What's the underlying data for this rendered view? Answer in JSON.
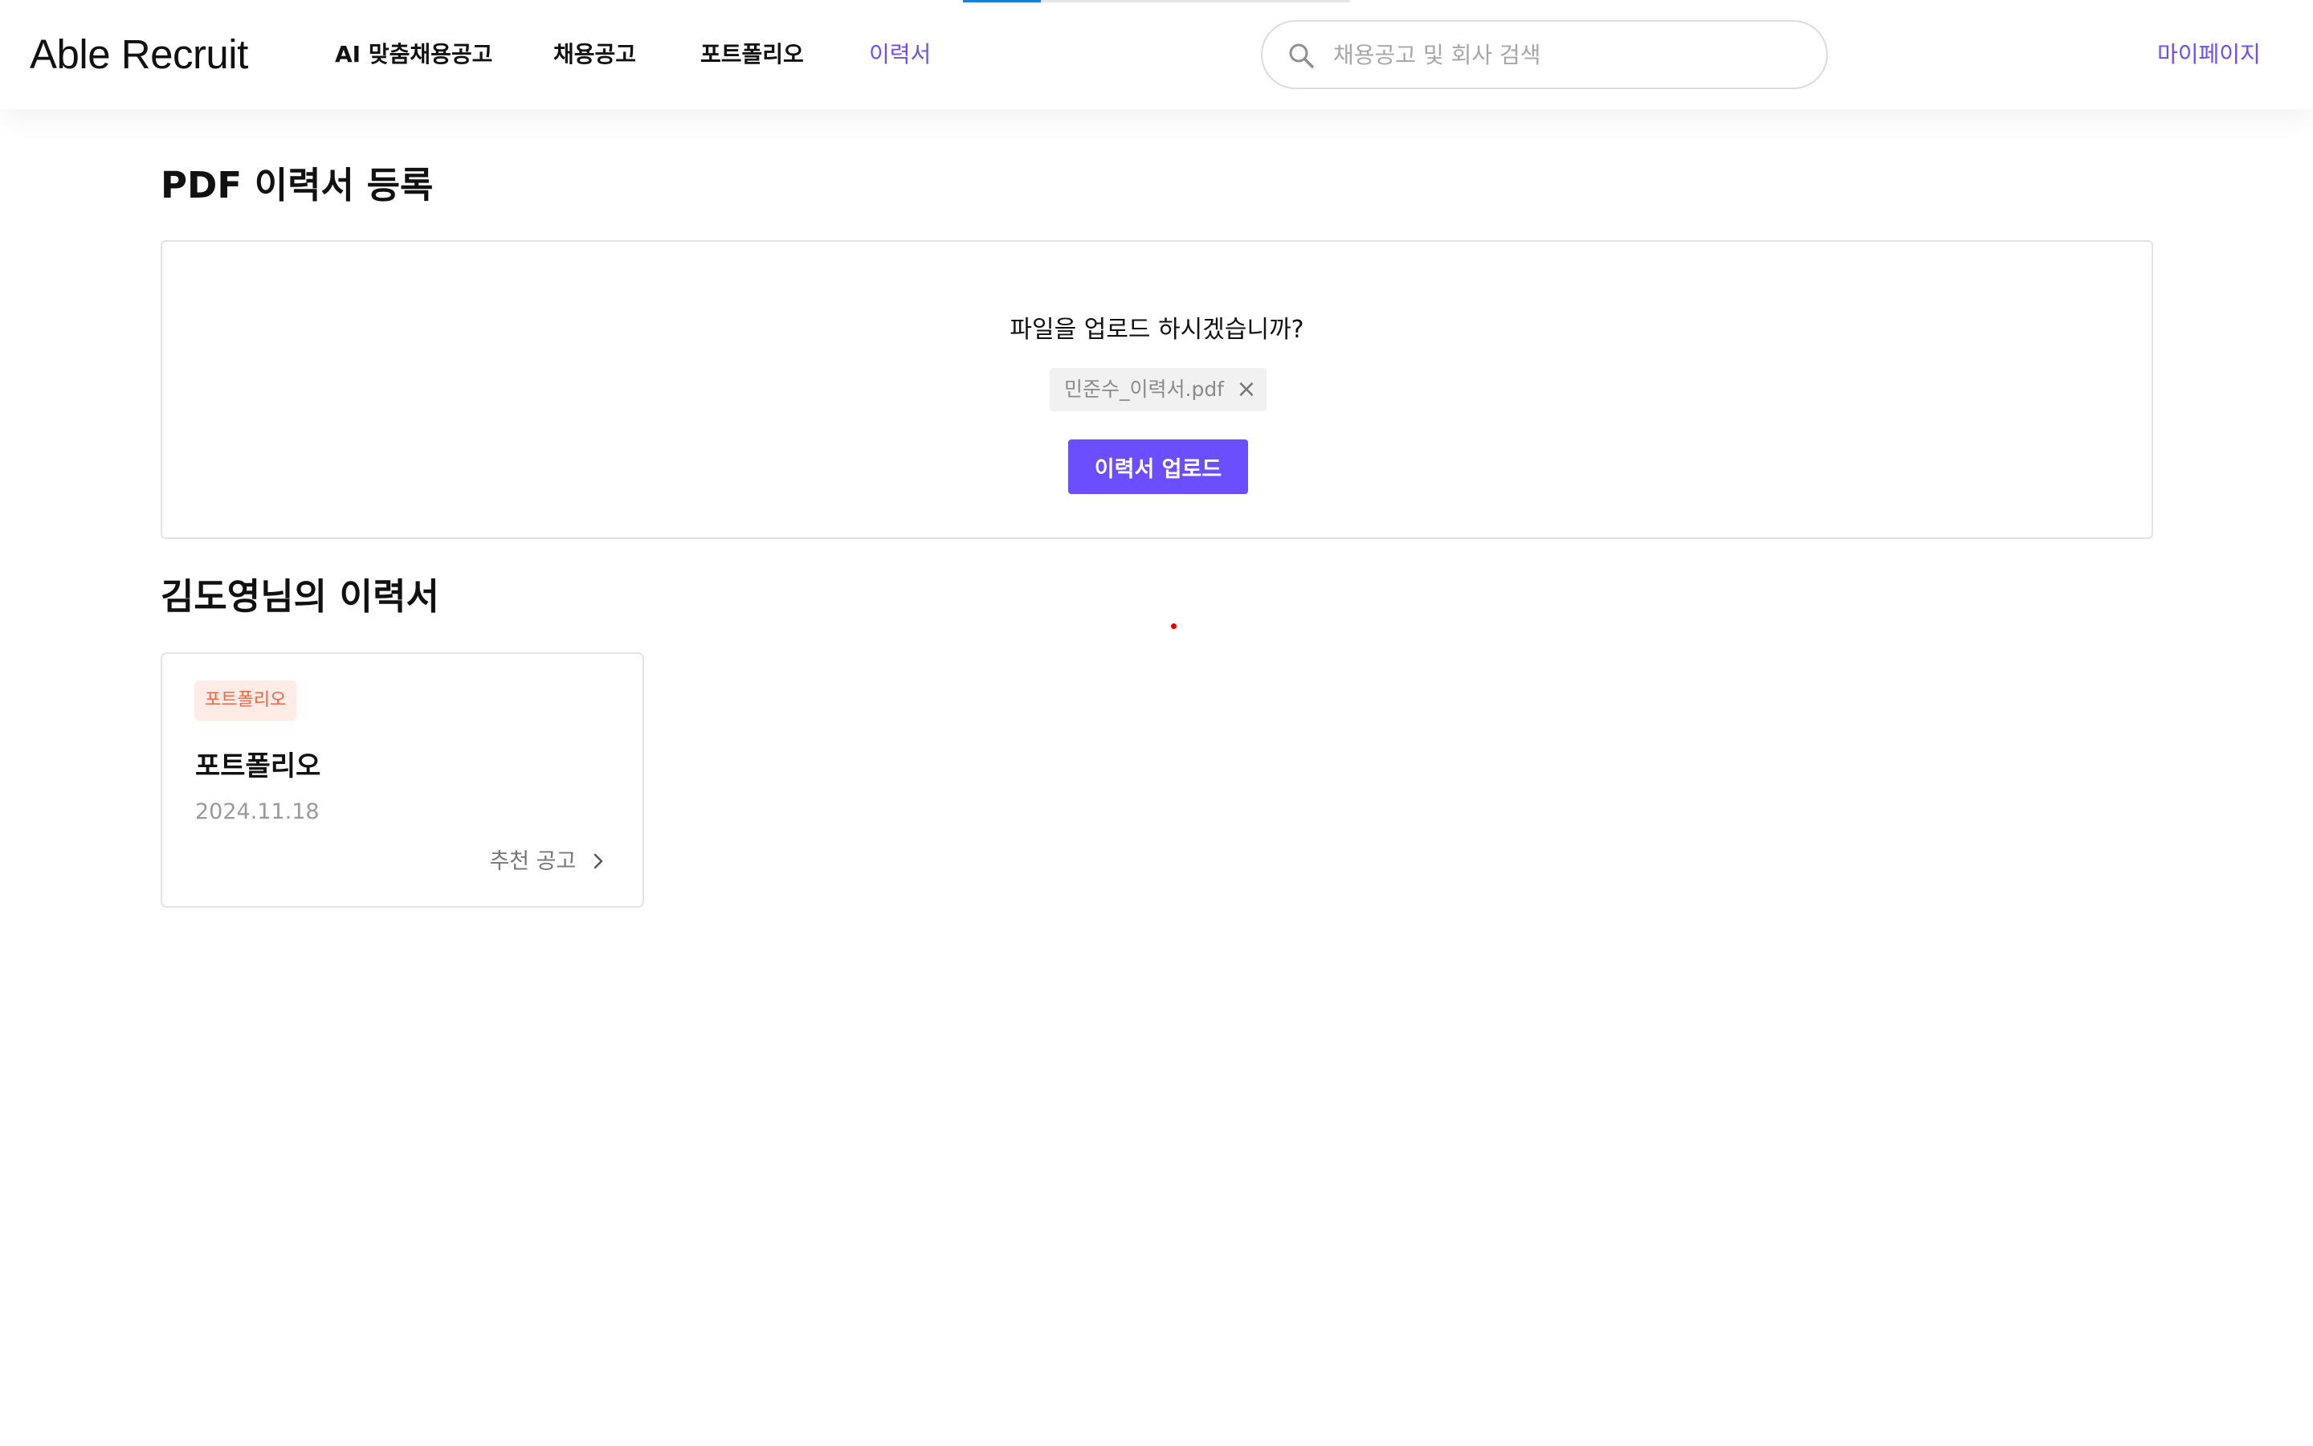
{
  "app": {
    "logo": "Able Recruit"
  },
  "nav": {
    "items": [
      {
        "label": "AI 맞춤채용공고"
      },
      {
        "label": "채용공고"
      },
      {
        "label": "포트폴리오"
      },
      {
        "label": "이력서"
      }
    ],
    "active": "이력서",
    "mypage": "마이페이지"
  },
  "search": {
    "placeholder": "채용공고 및 회사 검색",
    "value": "",
    "icon": "search-icon"
  },
  "upload": {
    "title": "PDF 이력서 등록",
    "question": "파일을 업로드 하시겠습니까?",
    "file_name": "민준수_이력서.pdf",
    "remove_icon": "×",
    "button_label": "이력서 업로드"
  },
  "resumes": {
    "title": "김도영님의 이력서",
    "cards": [
      {
        "badge": "포트폴리오",
        "title": "포트폴리오",
        "date": "2024.11.18",
        "link_label": "추천 공고"
      }
    ]
  },
  "colors": {
    "accent": "#6b4fff",
    "badge_bg": "#ffece7",
    "badge_text": "#f2674a",
    "top_progress": "#1a7fd6"
  }
}
